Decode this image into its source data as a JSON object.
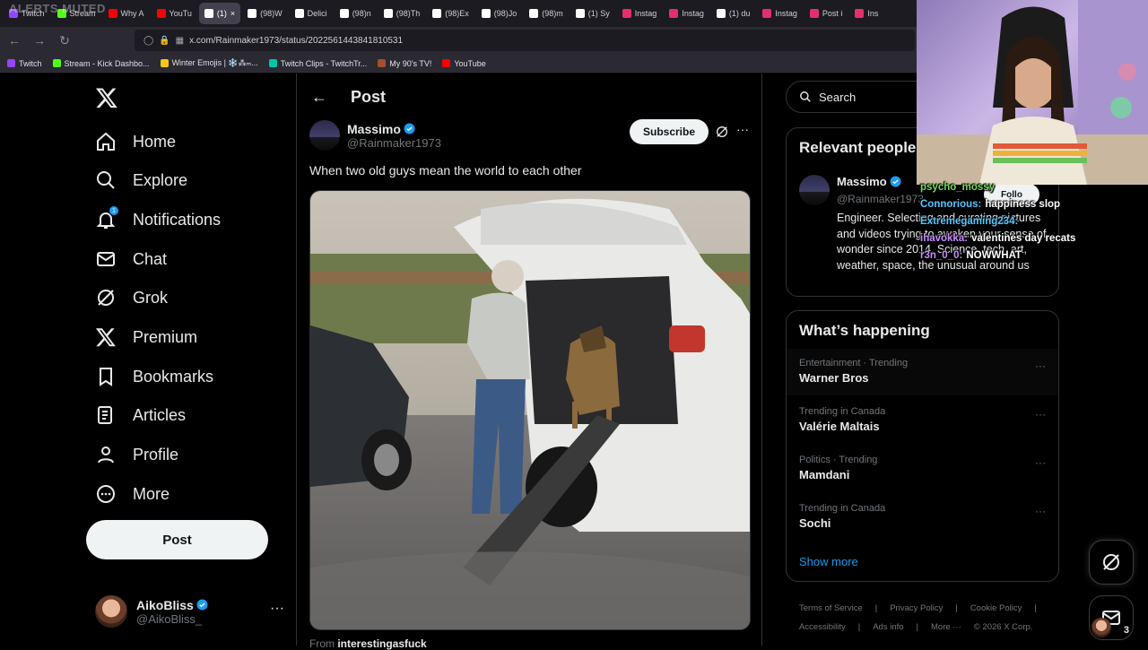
{
  "browser": {
    "overlay_text": "ALERTS MUTED",
    "tabs": [
      {
        "label": "Twitch",
        "color": "#9146ff",
        "active": false
      },
      {
        "label": "Stream",
        "color": "#53fc18",
        "active": false
      },
      {
        "label": "Why A",
        "color": "#ff0000",
        "active": false
      },
      {
        "label": "YouTu",
        "color": "#ff0000",
        "active": false
      },
      {
        "label": "(1)",
        "color": "#ffffff",
        "active": true
      },
      {
        "label": "(98)W",
        "color": "#ffffff",
        "active": false
      },
      {
        "label": "Delici",
        "color": "#ffffff",
        "active": false
      },
      {
        "label": "(98)n",
        "color": "#ffffff",
        "active": false
      },
      {
        "label": "(98)Th",
        "color": "#ffffff",
        "active": false
      },
      {
        "label": "(98)Ex",
        "color": "#ffffff",
        "active": false
      },
      {
        "label": "(98)Jo",
        "color": "#ffffff",
        "active": false
      },
      {
        "label": "(98)m",
        "color": "#ffffff",
        "active": false
      },
      {
        "label": "(1) Sy",
        "color": "#ffffff",
        "active": false
      },
      {
        "label": "Instag",
        "color": "#e1306c",
        "active": false
      },
      {
        "label": "Instag",
        "color": "#e1306c",
        "active": false
      },
      {
        "label": "(1) du",
        "color": "#ffffff",
        "active": false
      },
      {
        "label": "Instag",
        "color": "#e1306c",
        "active": false
      },
      {
        "label": "Post i",
        "color": "#e1306c",
        "active": false
      },
      {
        "label": "Ins",
        "color": "#e1306c",
        "active": false
      }
    ],
    "url": "x.com/Rainmaker1973/status/2022561443841810531",
    "bookmarks": [
      {
        "label": "Twitch",
        "color": "#9146ff"
      },
      {
        "label": "Stream - Kick Dashbo...",
        "color": "#53fc18"
      },
      {
        "label": "Winter Emojis | ❄️⁂ₘ...",
        "color": "#f5c518"
      },
      {
        "label": "Twitch Clips - TwitchTr...",
        "color": "#00c7ac"
      },
      {
        "label": "My 90's TV!",
        "color": "#a0522d"
      },
      {
        "label": "YouTube",
        "color": "#ff0000"
      }
    ]
  },
  "sidebar": {
    "items": [
      {
        "label": "Home",
        "icon": "home-icon"
      },
      {
        "label": "Explore",
        "icon": "search-icon"
      },
      {
        "label": "Notifications",
        "icon": "bell-icon",
        "badge": "1"
      },
      {
        "label": "Chat",
        "icon": "mail-icon"
      },
      {
        "label": "Grok",
        "icon": "grok-icon"
      },
      {
        "label": "Premium",
        "icon": "x-icon"
      },
      {
        "label": "Bookmarks",
        "icon": "bookmark-icon"
      },
      {
        "label": "Articles",
        "icon": "article-icon"
      },
      {
        "label": "Profile",
        "icon": "person-icon"
      },
      {
        "label": "More",
        "icon": "more-circle-icon"
      }
    ],
    "post_button": "Post",
    "account": {
      "name": "AikoBliss",
      "handle": "@AikoBliss_"
    }
  },
  "main": {
    "header": "Post",
    "author": {
      "name": "Massimo",
      "handle": "@Rainmaker1973"
    },
    "subscribe_label": "Subscribe",
    "text": "When two old guys mean the world to each other",
    "from_prefix": "From",
    "from_account": "interestingasfuck"
  },
  "right": {
    "search_placeholder": "Search",
    "relevant": {
      "title": "Relevant people",
      "name": "Massimo",
      "handle": "@Rainmaker1973",
      "follow_label": "Follo",
      "bio": "Engineer. Selecting and curating pictures and videos trying to awaken your sense of wonder since 2014. Science, tech, art, weather, space, the unusual around us"
    },
    "happening": {
      "title": "What’s happening",
      "trends": [
        {
          "meta": "Entertainment · Trending",
          "title": "Warner Bros"
        },
        {
          "meta": "Trending in Canada",
          "title": "Valérie Maltais"
        },
        {
          "meta": "Politics · Trending",
          "title": "Mamdani"
        },
        {
          "meta": "Trending in Canada",
          "title": "Sochi"
        }
      ],
      "show_more": "Show more"
    },
    "footer": [
      "Terms of Service",
      "|",
      "Privacy Policy",
      "|",
      "Cookie Policy",
      "|",
      "Accessibility",
      "|",
      "Ads info",
      "|",
      "More ···",
      "© 2026 X Corp."
    ],
    "chat_count": "3"
  },
  "stream_chat": [
    {
      "user": "psycho_mossy",
      "color": "green",
      "msg": ""
    },
    {
      "user": "Connorious:",
      "color": "cyan",
      "msg": "happiness slop"
    },
    {
      "user": "Extremegaming234:",
      "color": "cyan",
      "msg": ""
    },
    {
      "user": "ihavokka:",
      "color": "purple",
      "msg": "valentines day recats"
    },
    {
      "user": "r3n_0_0:",
      "color": "purple",
      "msg": "NOWWHAT"
    }
  ],
  "colors": {
    "accent": "#1d9bf0",
    "background": "#000000",
    "border": "#2f3336",
    "muted": "#71767b"
  }
}
